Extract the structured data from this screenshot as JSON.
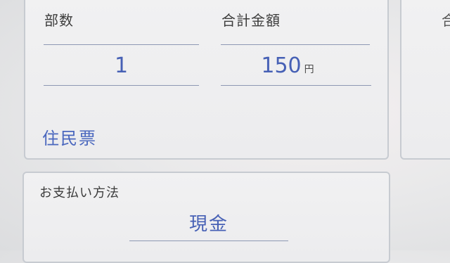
{
  "order": {
    "quantity_label": "部数",
    "quantity_value": "1",
    "total_label": "合計金額",
    "total_value": "150",
    "total_unit": "円",
    "document_type": "住民票"
  },
  "payment": {
    "label": "お支払い方法",
    "method": "現金"
  },
  "side_panel": {
    "label_fragment": "合"
  }
}
